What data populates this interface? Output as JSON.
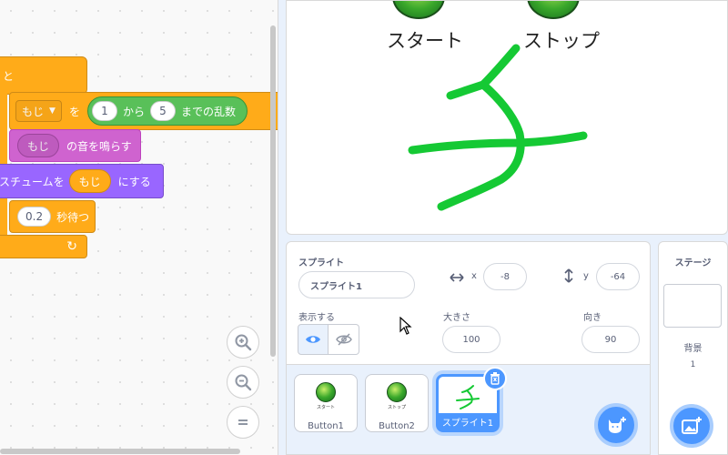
{
  "code": {
    "hat_fragment": "と",
    "set_block": {
      "dropdown_value": "もじ",
      "connector_wo": "を",
      "random": {
        "from": "1",
        "from_label": "から",
        "to": "5",
        "to_label": "までの乱数"
      }
    },
    "sound_block": {
      "var": "もじ",
      "label": "の音を鳴らす"
    },
    "costume_block": {
      "prefix": "スチュームを",
      "var": "もじ",
      "suffix": "にする"
    },
    "wait_block": {
      "value": "0.2",
      "label": "秒待つ"
    },
    "loop_arrow": "↻"
  },
  "stage": {
    "start_label": "スタート",
    "stop_label": "ストップ",
    "drawing_color": "#15c934"
  },
  "sprite_info": {
    "sprite_label": "スプライト",
    "sprite_name": "スプライト1",
    "x_label": "x",
    "x_value": "-8",
    "y_label": "y",
    "y_value": "-64",
    "show_label": "表示する",
    "size_label": "大きさ",
    "size_value": "100",
    "direction_label": "向き",
    "direction_value": "90"
  },
  "sprite_list": {
    "tiles": [
      {
        "name": "Button1",
        "thumb_text": "スタート"
      },
      {
        "name": "Button2",
        "thumb_text": "ストップ"
      },
      {
        "name": "スプライト1"
      }
    ]
  },
  "stage_panel": {
    "title": "ステージ",
    "backdrop_label": "背景",
    "backdrop_count": "1"
  },
  "colors": {
    "accent": "#4c97ff",
    "control": "#ffab19",
    "sound": "#cf63cf",
    "looks": "#9966ff",
    "operators": "#59c059"
  }
}
